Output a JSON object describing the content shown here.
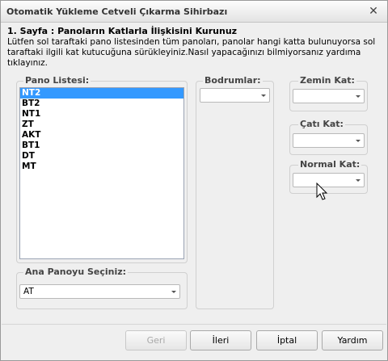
{
  "window": {
    "title": "Otomatik Yükleme Cetveli Çıkarma Sihirbazı",
    "close_glyph": "✕"
  },
  "page": {
    "header": "1. Sayfa : Panoların Katlarla İlişkisini Kurunuz",
    "instructions": "Lütfen sol taraftaki pano listesinden tüm panoları, panolar hangi katta bulunuyorsa sol taraftaki ilgili kat kutucuğuna sürükleyiniz.Nasıl yapacağınızı bilmiyorsanız yardıma tıklayınız."
  },
  "pano_listesi": {
    "label": "Pano Listesi:",
    "items": [
      "NT2",
      "BT2",
      "NT1",
      "ZT",
      "AKT",
      "BT1",
      "DT",
      "MT"
    ],
    "selected_index": 0
  },
  "ana_pano": {
    "label": "Ana Panoyu Seçiniz:",
    "value": "AT"
  },
  "bodrumlar": {
    "label": "Bodrumlar:",
    "value": ""
  },
  "zemin_kat": {
    "label": "Zemin Kat:",
    "value": ""
  },
  "cati_kat": {
    "label": "Çatı Kat:",
    "value": ""
  },
  "normal_kat": {
    "label": "Normal Kat:",
    "value": ""
  },
  "buttons": {
    "back": "Geri",
    "next": "İleri",
    "cancel": "İptal",
    "help": "Yardım"
  },
  "icons": {
    "close": "close-icon",
    "dropdown": "chevron-down-icon",
    "cursor": "hand-cursor-icon"
  },
  "colors": {
    "selection": "#3399ff",
    "window_bg": "#efefef"
  }
}
